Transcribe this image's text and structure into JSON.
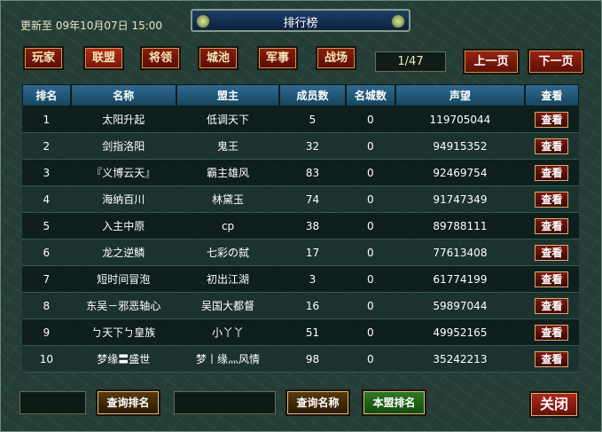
{
  "header": {
    "update_text": "更新至 09年10月07日 15:00",
    "title": "排行榜"
  },
  "tabs": [
    {
      "label": "玩家"
    },
    {
      "label": "联盟",
      "active": true
    },
    {
      "label": "将领"
    },
    {
      "label": "城池"
    },
    {
      "label": "军事"
    },
    {
      "label": "战场"
    }
  ],
  "pagination": {
    "page_text": "1/47",
    "prev_label": "上一页",
    "next_label": "下一页"
  },
  "table": {
    "columns": [
      "排名",
      "名称",
      "盟主",
      "成员数",
      "名城数",
      "声望",
      "查看"
    ],
    "rows": [
      {
        "rank": "1",
        "name": "太阳升起",
        "leader": "低调天下",
        "members": "5",
        "cities": "0",
        "prestige": "119705044",
        "view": "查看"
      },
      {
        "rank": "2",
        "name": "剑指洛阳",
        "leader": "鬼王",
        "members": "32",
        "cities": "0",
        "prestige": "94915352",
        "view": "查看"
      },
      {
        "rank": "3",
        "name": "『义博云天』",
        "leader": "霸主雄风",
        "members": "83",
        "cities": "0",
        "prestige": "92469754",
        "view": "查看"
      },
      {
        "rank": "4",
        "name": "海纳百川",
        "leader": "林黛玉",
        "members": "74",
        "cities": "0",
        "prestige": "91747349",
        "view": "查看"
      },
      {
        "rank": "5",
        "name": "入主中原",
        "leader": "cp",
        "members": "38",
        "cities": "0",
        "prestige": "89788111",
        "view": "查看"
      },
      {
        "rank": "6",
        "name": "龙之逆鳞",
        "leader": "七彩の弑",
        "members": "17",
        "cities": "0",
        "prestige": "77613408",
        "view": "查看"
      },
      {
        "rank": "7",
        "name": "短时间冒泡",
        "leader": "初出江湖",
        "members": "3",
        "cities": "0",
        "prestige": "61774199",
        "view": "查看"
      },
      {
        "rank": "8",
        "name": "东吴－邪恶轴心",
        "leader": "吴国大都督",
        "members": "16",
        "cities": "0",
        "prestige": "59897044",
        "view": "查看"
      },
      {
        "rank": "9",
        "name": "ㄅ天下ㄅ皇族",
        "leader": "小丫丫",
        "members": "51",
        "cities": "0",
        "prestige": "49952165",
        "view": "查看"
      },
      {
        "rank": "10",
        "name": "梦缘〓盛世",
        "leader": "梦丨缘灬风情",
        "members": "98",
        "cities": "0",
        "prestige": "35242213",
        "view": "查看"
      }
    ]
  },
  "footer": {
    "rank_input_value": "",
    "query_rank_label": "查询排名",
    "name_input_value": "",
    "query_name_label": "查询名称",
    "my_alliance_label": "本盟排名",
    "close_label": "关闭"
  }
}
